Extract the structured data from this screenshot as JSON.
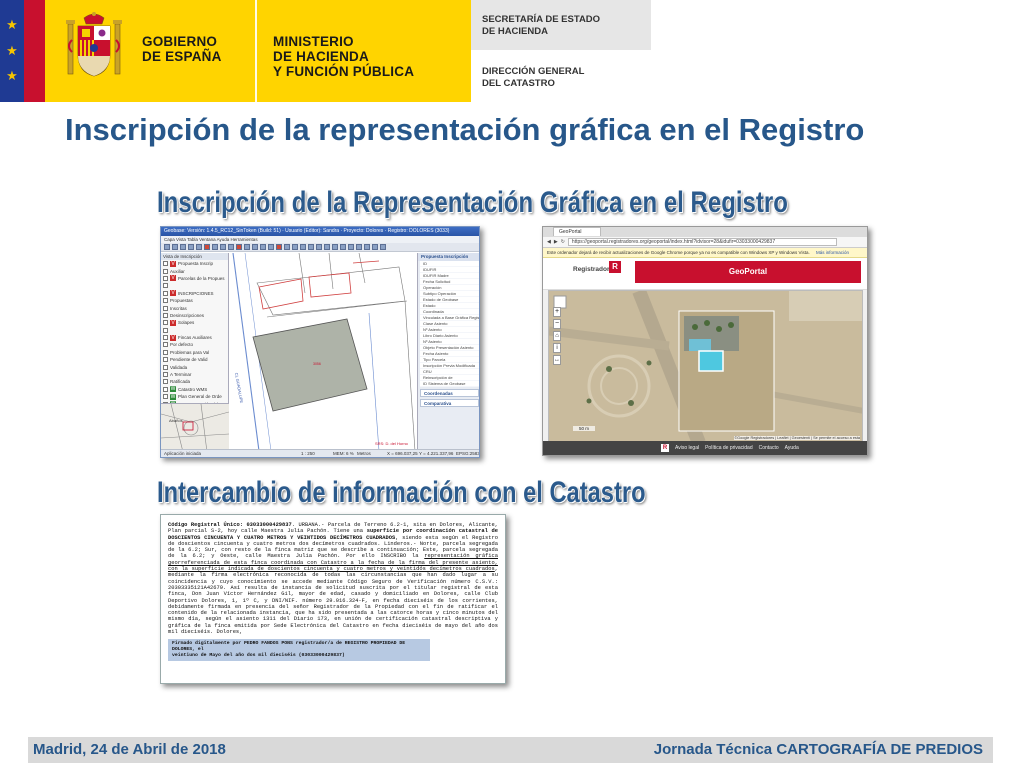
{
  "header": {
    "flag_stars": [
      "★",
      "★",
      "★"
    ],
    "gov_line1": "GOBIERNO",
    "gov_line2": "DE ESPAÑA",
    "min_line1": "MINISTERIO",
    "min_line2": "DE HACIENDA",
    "min_line3": "Y FUNCIÓN PÚBLICA",
    "sec_line1": "SECRETARÍA DE ESTADO",
    "sec_line2": "DE HACIENDA",
    "dir_line1": "DIRECCIÓN GENERAL",
    "dir_line2": "DEL CATASTRO",
    "colors": {
      "flag_blue": "#1f3a93",
      "flag_red": "#c8102e",
      "gov_yellow": "#ffd400",
      "title_blue": "#27578a"
    }
  },
  "main_title": "Inscripción de la representación gráfica en el Registro",
  "section1_title": "Inscripción de la Representación Gráfica en el Registro",
  "section2_title": "Intercambio de información con el Catastro",
  "gis_app": {
    "window_title": "Geobase: Versión: 1.4.5_RC12_SinToken (Build: 51) · Usuario (Editor): Sandra · Proyecto: Dolores · Registro: DOLORES (3033)",
    "menu": "Capa   Vista   Tabla   Ventana   Ayuda   Herramientas",
    "layers_title": "Vista de Inscripción",
    "layers": [
      {
        "badge": "V",
        "label": "Propuesta Inscrip"
      },
      {
        "badge": "",
        "label": "Auxiliar"
      },
      {
        "badge": "V",
        "label": "Parcelas de la Propues"
      },
      {
        "badge": "",
        "label": ""
      },
      {
        "badge": "V",
        "label": "INSCRIPCIONES"
      },
      {
        "badge": "",
        "label": "Propuestas"
      },
      {
        "badge": "",
        "label": "Inscritas"
      },
      {
        "badge": "",
        "label": "Desinscripciones"
      },
      {
        "badge": "V",
        "label": "Solapes"
      },
      {
        "badge": "",
        "label": ""
      },
      {
        "badge": "V",
        "label": "Fincas Auxiliares"
      },
      {
        "badge": "",
        "label": "Por defecto"
      },
      {
        "badge": "",
        "label": "Problemas para Val"
      },
      {
        "badge": "",
        "label": "Pendiente de Valid"
      },
      {
        "badge": "",
        "label": "Validada"
      },
      {
        "badge": "",
        "label": "A Terminar"
      },
      {
        "badge": "",
        "label": "Ratificada"
      },
      {
        "badge": "W",
        "label": "Catastro WMS"
      },
      {
        "badge": "W",
        "label": "Plan General de Orde"
      },
      {
        "badge": "W",
        "label": "Mapa ocupación del s"
      },
      {
        "badge": "W",
        "label": "Áreas de riesgo poten"
      }
    ],
    "props_title": "Propuesta Inscripción",
    "props": [
      "ID",
      "IDUFIR",
      "IDUFIR Madre",
      "Fecha Solicitud",
      "Operación",
      "Subtipo Operación",
      "Estado de Geobase",
      "Estado",
      "Coordinada",
      "Vinculada a Base Gráfica Regis",
      "Clase Asiento",
      "Nº Asiento",
      "Libro Diario Asiento",
      "Nº Asiento",
      "Objeto Presentación Asiento",
      "Fecha Asiento",
      "Tipo Parcela",
      "Inscripción Previa Modificada",
      "CRU",
      "Reinscripción de",
      "ID Sistema de Geobase"
    ],
    "panel_coords": "Coordenadas",
    "panel_compare": "Comparativa",
    "map_label": "Abaños",
    "map_street": "Calle Guadalupe",
    "map_coords": "SRS: D. del Horno",
    "status": "Aplicación iniciada",
    "status_scale": "1 : 250",
    "status_mem": "MEM: 6 %",
    "status_units": "Metros",
    "status_x": "X = 696.037,25",
    "status_y": "Y = 4.221.337,96",
    "status_epsg": "EPSG:25830"
  },
  "geoportal": {
    "tab": "GeoPortal",
    "url": "https://geoportal.registradores.org/geoportal/index.html?idvisor=28&idufir=03033000429837",
    "warning": "Este ordenador dejará de recibir actualizaciones de Google Chrome porque ya no es compatible con Windows XP y Windows Vista.",
    "warning_link": "Más información",
    "logo_text": "Registradores",
    "logo_mark": "R",
    "banner": "GeoPortal",
    "attribution": "©Google Registradores | Leaflet | Geoestenti | Se permite el acceso a esta",
    "scale_label": "50 m",
    "footer_links": [
      "Aviso legal",
      "Política de privacidad",
      "Contacto",
      "Ayuda"
    ]
  },
  "document": {
    "line_prefix_bold": "Código Registral Único: 03033000429837",
    "text1": ". URBANA.- Parcela de Terreno 6.2-1, sita en Dolores, Alicante, Plan parcial S-2, hoy calle Maestra Julia Pachón. Tiene una ",
    "bold2": "superficie por coordinación catastral de DOSCIENTOS CINCUENTA Y CUATRO METROS Y VEINTIDOS DECÍMETROS CUADRADOS",
    "text3": ", siendo esta según el Registro de doscientos cincuenta y cuatro metros dos decímetros cuadrados. Linderos.- Norte, parcela segregada de la 6.2; Sur, con resto de la finca matriz que se describe a continuación; Este, parcela segregada de la 6.2; y Oeste, calle Maestra Julia Pachón. Por ello INSCRIBO la ",
    "underline4": "representación gráfica georreferenciada de esta finca coordinada con Catastro a la fecha de la firma del presente asiento, con la superficie indicada de doscientos cincuenta y cuatro metros y veintidós decímetros cuadrados",
    "text5": ", mediante la firma electrónica reconocida de todas las circunstancias que han dado lugar a su coincidencia y cuyo conocimiento se accede mediante Código Seguro de Verificación número C.S.V.: 20303335121A42679. Así resulta de instancia de solicitud suscrita por el titular registral de esta finca, Don Juan Víctor Hernández Gil, mayor de edad, casado y domiciliado en Dolores, calle Club Deportivo Dolores, 1, 1º C, y DNI/NIF. número 29.016.324-F, en fecha dieciséis de los corrientes, debidamente firmada en presencia del señor Registrador de la Propiedad con el fin de ratificar el contenido de la relacionada instancia, que ha sido presentada a las catorce horas y cinco minutos del mismo día, según el asiento 1311 del Diario 173, en unión de certificación catastral descriptiva y gráfica de la finca emitida por Sede Electrónica del Catastro en fecha dieciséis de mayo del año dos mil dieciséis. Dolores,",
    "sign_line1": "Firmado digitalmente por PEDRO FANDOS PONS registrador/a de REGISTRO PROPIEDAD DE DOLORES, el",
    "sign_line2": "veintiuno de Mayo del año dos mil dieciséis (03033000429837)"
  },
  "footer": {
    "left": "Madrid, 24 de Abril de 2018",
    "right_prefix": "Jornada Técnica ",
    "right_bold": "CARTOGRAFÍA DE PREDIOS"
  }
}
